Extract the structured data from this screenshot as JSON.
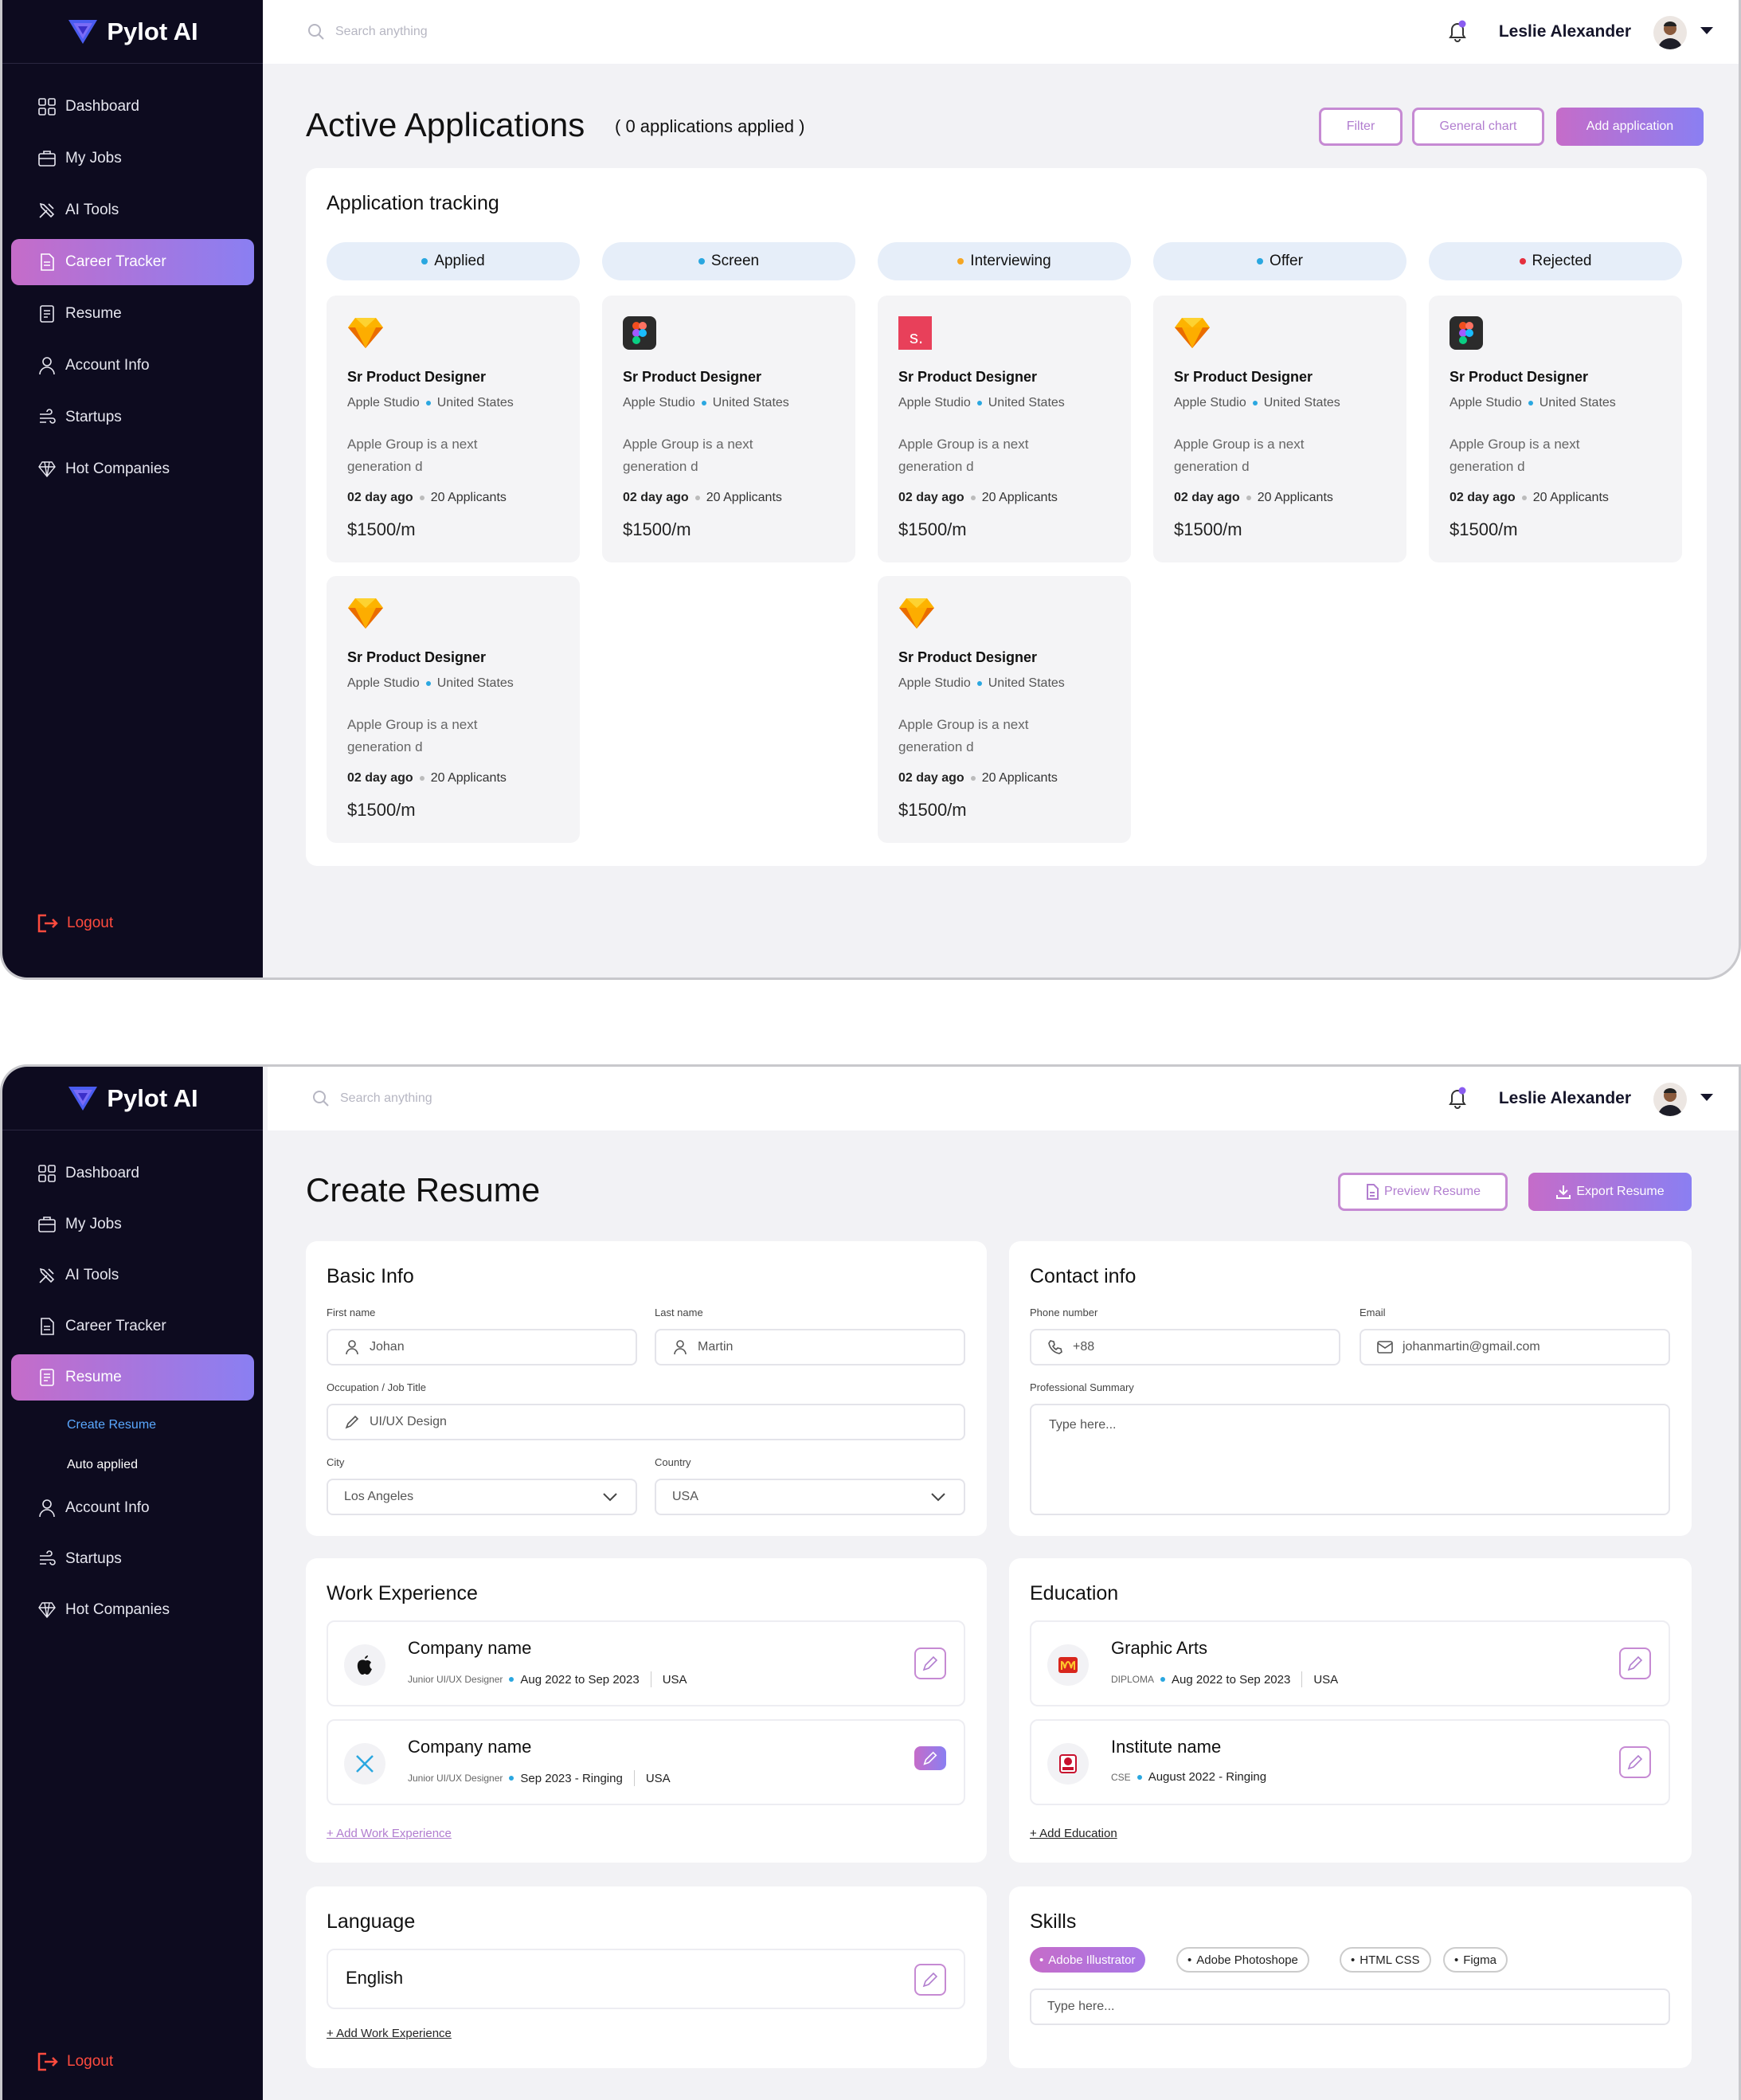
{
  "brand": {
    "name": "Pylot AI",
    "accent": "#c56cc9",
    "accent2": "#8a7ff2",
    "sidebar_bg": "#0d0b1f"
  },
  "screen1": {
    "nav": [
      {
        "label": "Dashboard",
        "icon": "dashboard-icon"
      },
      {
        "label": "My Jobs",
        "icon": "briefcase-icon"
      },
      {
        "label": "AI Tools",
        "icon": "tools-icon"
      },
      {
        "label": "Career Tracker",
        "icon": "document-icon",
        "active": true
      },
      {
        "label": "Resume",
        "icon": "resume-icon"
      },
      {
        "label": "Account Info",
        "icon": "user-icon"
      },
      {
        "label": "Startups",
        "icon": "startups-icon"
      },
      {
        "label": "Hot Companies",
        "icon": "diamond-icon"
      }
    ],
    "logout": "Logout",
    "search_placeholder": "Search anything",
    "user_name": "Leslie Alexander",
    "title": "Active Applications",
    "subtitle": "( 0 applications applied )",
    "buttons": {
      "filter": "Filter",
      "chart": "General chart",
      "add": "Add application"
    },
    "tracking_title": "Application tracking",
    "columns": [
      {
        "label": "Applied",
        "dot": "#2aa7e0"
      },
      {
        "label": "Screen",
        "dot": "#2aa7e0"
      },
      {
        "label": "Interviewing",
        "dot": "#f5a623"
      },
      {
        "label": "Offer",
        "dot": "#2aa7e0"
      },
      {
        "label": "Rejected",
        "dot": "#e5303e"
      }
    ],
    "job": {
      "title": "Sr Product Designer",
      "company": "Apple Studio",
      "location": "United States",
      "desc": "Apple Group is a next generation d",
      "posted": "02 day ago",
      "applicants": "20 Applicants",
      "salary": "$1500/m"
    }
  },
  "screen2": {
    "nav": [
      {
        "label": "Dashboard",
        "icon": "dashboard-icon"
      },
      {
        "label": "My Jobs",
        "icon": "briefcase-icon"
      },
      {
        "label": "AI Tools",
        "icon": "tools-icon"
      },
      {
        "label": "Career Tracker",
        "icon": "document-icon"
      },
      {
        "label": "Resume",
        "icon": "resume-icon",
        "active": true
      },
      {
        "label": "Create Resume",
        "sub": true,
        "active": true
      },
      {
        "label": "Auto applied",
        "sub": true
      },
      {
        "label": "Account Info",
        "icon": "user-icon"
      },
      {
        "label": "Startups",
        "icon": "startups-icon"
      },
      {
        "label": "Hot Companies",
        "icon": "diamond-icon"
      }
    ],
    "logout": "Logout",
    "search_placeholder": "Search anything",
    "user_name": "Leslie Alexander",
    "title": "Create Resume",
    "buttons": {
      "preview": "Preview Resume",
      "export": "Export Resume"
    },
    "basic": {
      "title": "Basic Info",
      "first_label": "First name",
      "first_value": "Johan",
      "last_label": "Last name",
      "last_value": "Martin",
      "occ_label": "Occupation / Job Title",
      "occ_value": "UI/UX Design",
      "city_label": "City",
      "city_value": "Los Angeles",
      "country_label": "Country",
      "country_value": "USA"
    },
    "contact": {
      "title": "Contact info",
      "phone_label": "Phone number",
      "phone_value": "+88",
      "email_label": "Email",
      "email_value": "johanmartin@gmail.com",
      "summary_label": "Professional Summary",
      "summary_placeholder": "Type here..."
    },
    "work": {
      "title": "Work Experience",
      "items": [
        {
          "name": "Company name",
          "role": "Junior UI/UX Designer",
          "period": "Aug 2022 to Sep 2023",
          "country": "USA"
        },
        {
          "name": "Company name",
          "role": "Junior UI/UX Designer",
          "period": "Sep 2023 - Ringing",
          "country": "USA"
        }
      ],
      "add": "+ Add Work Experience"
    },
    "education": {
      "title": "Education",
      "items": [
        {
          "name": "Graphic Arts",
          "role": "DIPLOMA",
          "period": "Aug 2022 to Sep 2023",
          "country": "USA"
        },
        {
          "name": "Institute name",
          "role": "CSE",
          "period": "August 2022 - Ringing"
        }
      ],
      "add": "+ Add Education"
    },
    "language": {
      "title": "Language",
      "value": "English",
      "add": "+ Add Work Experience"
    },
    "skills": {
      "title": "Skills",
      "items": [
        "Adobe Illustrator",
        "Adobe Photoshope",
        "HTML CSS",
        "Figma"
      ],
      "placeholder": "Type here..."
    }
  }
}
